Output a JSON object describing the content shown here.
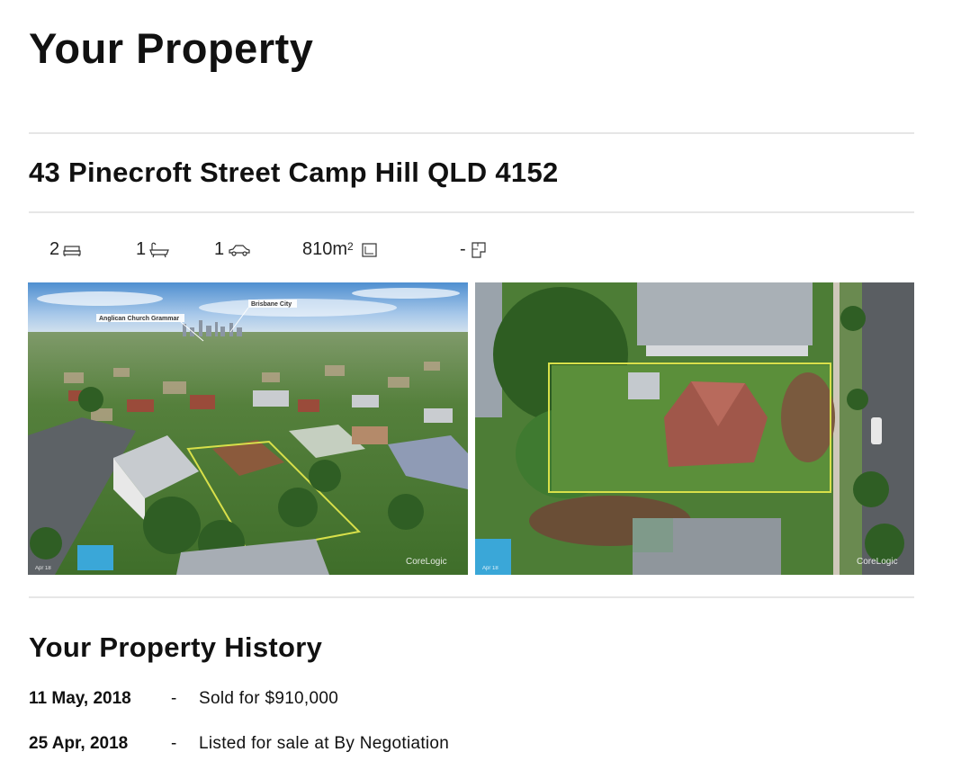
{
  "page": {
    "title": "Your Property",
    "address": "43 Pinecroft Street Camp Hill QLD 4152"
  },
  "features": {
    "beds": "2",
    "baths": "1",
    "cars": "1",
    "land_area": "810m",
    "land_area_sup": "2",
    "floor_area": "-"
  },
  "photos": {
    "aerial_label_1": "Anglican Church Grammar",
    "aerial_label_2": "Brisbane City",
    "watermark": "CoreLogic",
    "date_stamp": "Apr 18"
  },
  "history": {
    "heading": "Your Property History",
    "rows": [
      {
        "date": "11 May, 2018",
        "dash": "-",
        "description": "Sold for $910,000"
      },
      {
        "date": "25 Apr, 2018",
        "dash": "-",
        "description": "Listed for sale at By Negotiation"
      }
    ]
  },
  "colors": {
    "boundary": "#d8e04a",
    "rule": "#e6e6e6"
  }
}
